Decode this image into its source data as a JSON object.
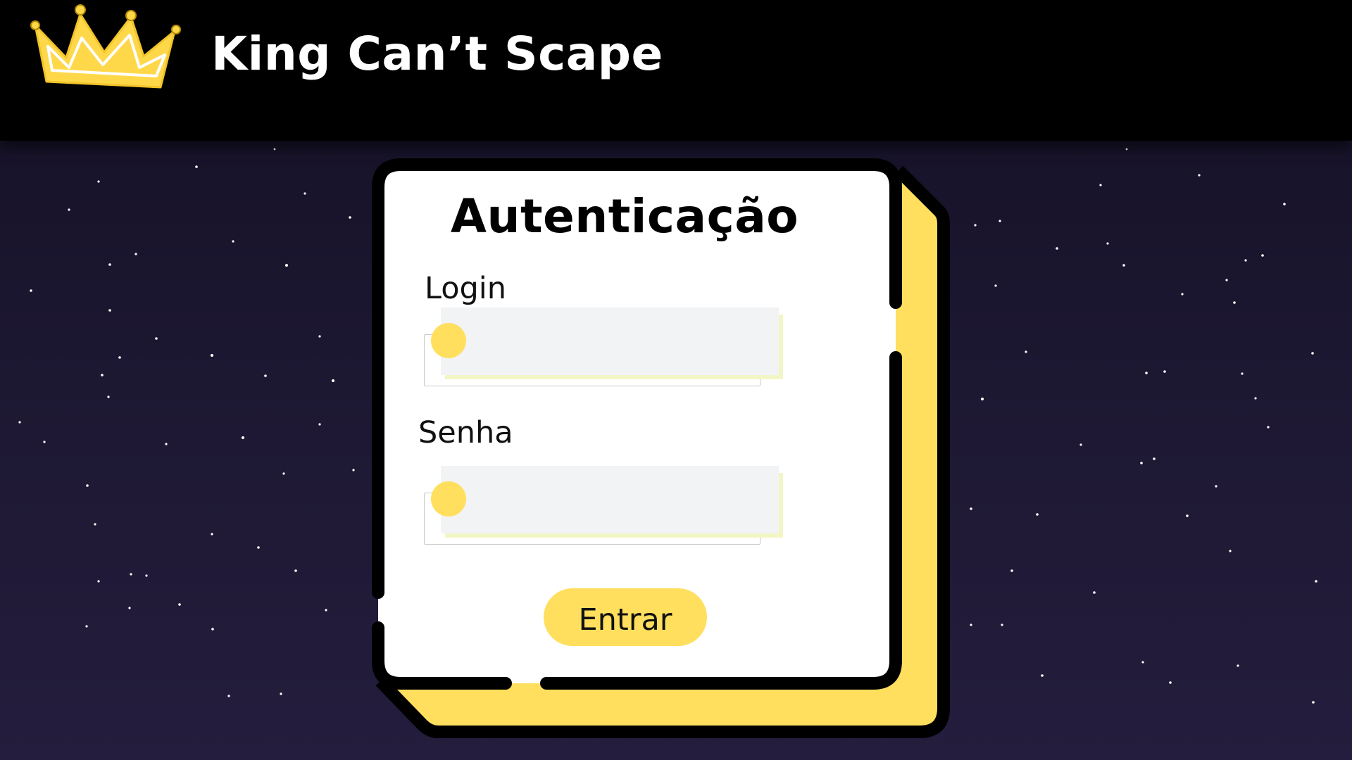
{
  "header": {
    "app_title": "King Can’t Scape",
    "logo_icon": "crown-icon"
  },
  "auth_card": {
    "title": "Autenticação",
    "login": {
      "label": "Login",
      "value": "",
      "placeholder": ""
    },
    "password": {
      "label": "Senha",
      "value": "",
      "placeholder": ""
    },
    "submit_label": "Entrar"
  },
  "colors": {
    "header_background": "#000000",
    "page_background_top": "#141024",
    "page_background_bottom": "#241d3d",
    "accent_yellow": "#ffdf5d",
    "card_background": "#ffffff",
    "card_outline": "#000000",
    "input_background": "#f2f3f5",
    "input_highlight": "#f2f6c5"
  }
}
